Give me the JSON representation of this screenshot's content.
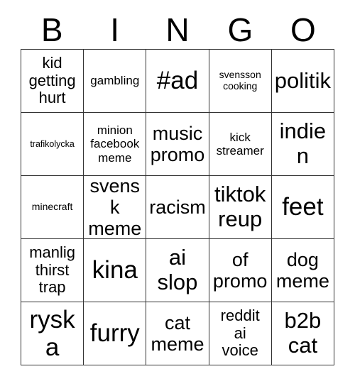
{
  "card": {
    "header_letters": [
      "B",
      "I",
      "N",
      "G",
      "O"
    ],
    "rows": [
      [
        {
          "text": "kid\ngetting\nhurt",
          "size": "md"
        },
        {
          "text": "gambling",
          "size": "sm"
        },
        {
          "text": "#ad",
          "size": "xxl"
        },
        {
          "text": "svensson\ncooking",
          "size": "xs"
        },
        {
          "text": "politik",
          "size": "xl"
        }
      ],
      [
        {
          "text": "trafikolycka",
          "size": "xxs"
        },
        {
          "text": "minion\nfacebook\nmeme",
          "size": "sm"
        },
        {
          "text": "music\npromo",
          "size": "lg"
        },
        {
          "text": "kick\nstreamer",
          "size": "sm"
        },
        {
          "text": "indien",
          "size": "xl"
        }
      ],
      [
        {
          "text": "minecraft",
          "size": "xs"
        },
        {
          "text": "svensk\nmeme",
          "size": "lg"
        },
        {
          "text": "racism",
          "size": "lg"
        },
        {
          "text": "tiktok\nreup",
          "size": "xl"
        },
        {
          "text": "feet",
          "size": "xxl"
        }
      ],
      [
        {
          "text": "manlig\nthirst\ntrap",
          "size": "md"
        },
        {
          "text": "kina",
          "size": "xxl"
        },
        {
          "text": "ai\nslop",
          "size": "xl"
        },
        {
          "text": "of\npromo",
          "size": "lg"
        },
        {
          "text": "dog\nmeme",
          "size": "lg"
        }
      ],
      [
        {
          "text": "ryska",
          "size": "xxl"
        },
        {
          "text": "furry",
          "size": "xxl"
        },
        {
          "text": "cat\nmeme",
          "size": "lg"
        },
        {
          "text": "reddit\nai\nvoice",
          "size": "md"
        },
        {
          "text": "b2b\ncat",
          "size": "xl"
        }
      ]
    ]
  }
}
